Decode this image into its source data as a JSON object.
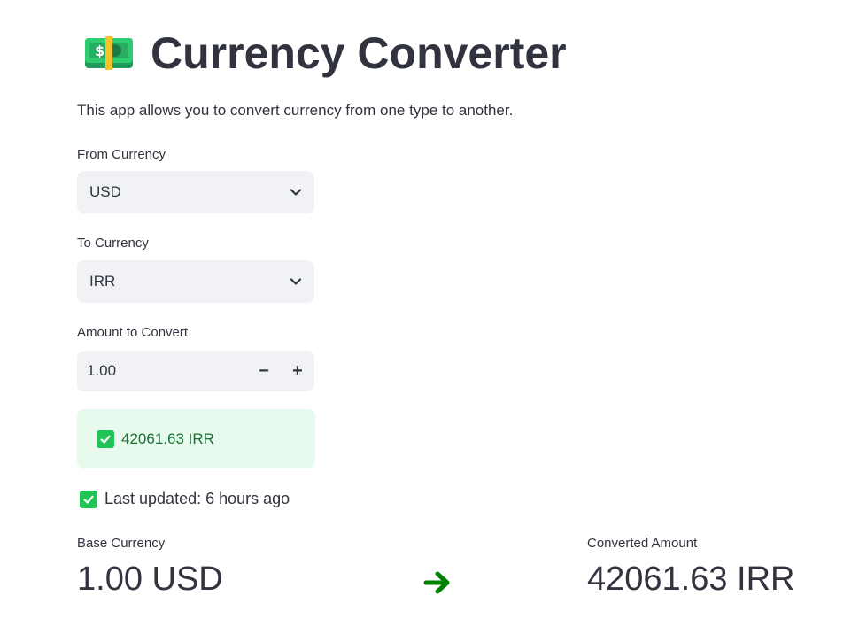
{
  "header": {
    "title": "Currency Converter",
    "icon": "money-icon",
    "description": "This app allows you to convert currency from one type to another."
  },
  "from_currency": {
    "label": "From Currency",
    "value": "USD"
  },
  "to_currency": {
    "label": "To Currency",
    "value": "IRR"
  },
  "amount": {
    "label": "Amount to Convert",
    "value": "1.00",
    "decrement": "−",
    "increment": "+"
  },
  "result": {
    "text": "42061.63 IRR"
  },
  "updated": {
    "text": "Last updated: 6 hours ago"
  },
  "metrics": {
    "base_label": "Base Currency",
    "base_value": "1.00 USD",
    "converted_label": "Converted Amount",
    "converted_value": "42061.63 IRR"
  },
  "colors": {
    "accent_green": "#21c354",
    "success_bg": "#e8f9ee",
    "success_text": "#177233",
    "arrow": "#008000",
    "input_bg": "#f0f2f6"
  }
}
